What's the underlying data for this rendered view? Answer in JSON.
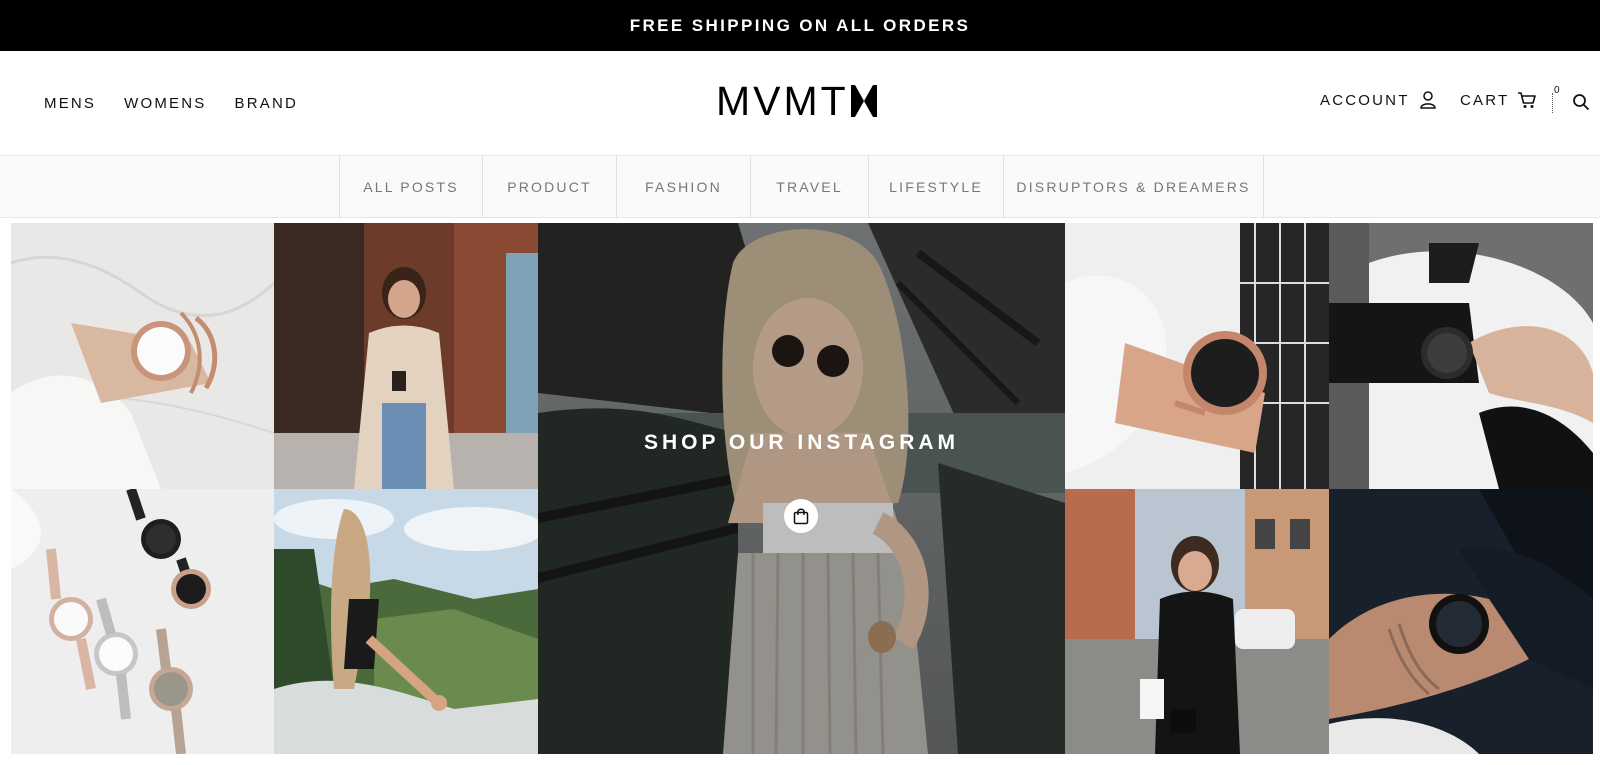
{
  "announcement": "FREE SHIPPING ON ALL ORDERS",
  "nav": {
    "mens": "MENS",
    "womens": "WOMENS",
    "brand": "BRAND"
  },
  "logo": "MVMT",
  "account": {
    "label": "ACCOUNT",
    "icon": "user-icon"
  },
  "cart": {
    "label": "CART",
    "count": "0",
    "icon": "cart-icon"
  },
  "search": {
    "icon": "search-icon"
  },
  "categories": [
    "ALL POSTS",
    "PRODUCT",
    "FASHION",
    "TRAVEL",
    "LIFESTYLE",
    "DISRUPTORS & DREAMERS"
  ],
  "instagram": {
    "heading": "SHOP OUR INSTAGRAM",
    "button_icon": "shopping-bag-icon"
  },
  "colors": {
    "announcement_bg": "#000000",
    "text": "#111111",
    "category_text": "#777777",
    "category_bg": "#fafafa"
  }
}
